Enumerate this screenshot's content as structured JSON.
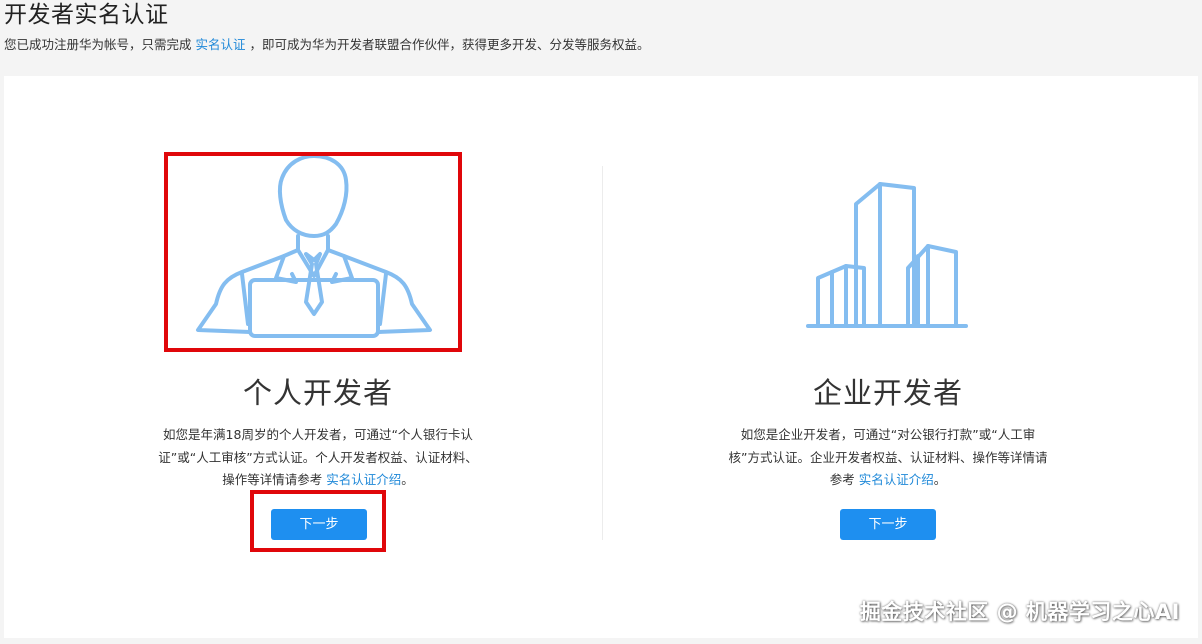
{
  "header": {
    "title": "开发者实名认证",
    "subtitle_before": "您已成功注册华为帐号，只需完成",
    "subtitle_link": "实名认证",
    "subtitle_after": "，即可成为华为开发者联盟合作伙伴，获得更多开发、分发等服务权益。"
  },
  "personal": {
    "title": "个人开发者",
    "desc": "如您是年满18周岁的个人开发者，可通过“个人银行卡认证”或“人工审核”方式认证。个人开发者权益、认证材料、操作等详情请参考",
    "link": "实名认证介绍",
    "desc_end": "。",
    "button": "下一步",
    "icon": "developer-person-icon"
  },
  "enterprise": {
    "title": "企业开发者",
    "desc": "如您是企业开发者，可通过“对公银行打款”或“人工审核”方式认证。企业开发者权益、认证材料、操作等详情请参考",
    "link": "实名认证介绍",
    "desc_end": "。",
    "button": "下一步",
    "icon": "enterprise-building-icon"
  },
  "watermark": "掘金技术社区 @ 机器学习之心AI",
  "colors": {
    "accent": "#1e8ff0",
    "link": "#1e88d8",
    "highlight": "#e0070a",
    "illustration": "#84bdf0"
  }
}
